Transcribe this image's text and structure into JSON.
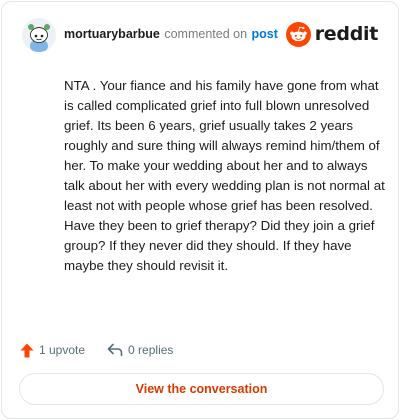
{
  "header": {
    "username": "mortuarybarbue",
    "verb": "commented on",
    "link_text": "post",
    "brand": "reddit"
  },
  "comment": {
    "text": "NTA . Your fiance and his family have gone from what is called complicated grief into full blown unresolved grief. Its been 6 years, grief usually takes 2 years roughly and sure thing will always remind him/them of her. To make your wedding about her and to always talk about her with every wedding plan is not normal at least not with people whose grief has been resolved. Have they been to grief therapy? Did they join a grief group? If they never did they should. If they have maybe they should revisit it."
  },
  "footer": {
    "upvote_label": "1 upvote",
    "replies_label": "0 replies"
  },
  "cta": {
    "label": "View the conversation"
  },
  "colors": {
    "brand_orange": "#ff4500",
    "link_blue": "#0079d3",
    "cta_text": "#d93a00"
  },
  "icons": [
    "avatar",
    "reddit-snoo-icon",
    "upvote-arrow-icon",
    "reply-arrow-icon"
  ]
}
